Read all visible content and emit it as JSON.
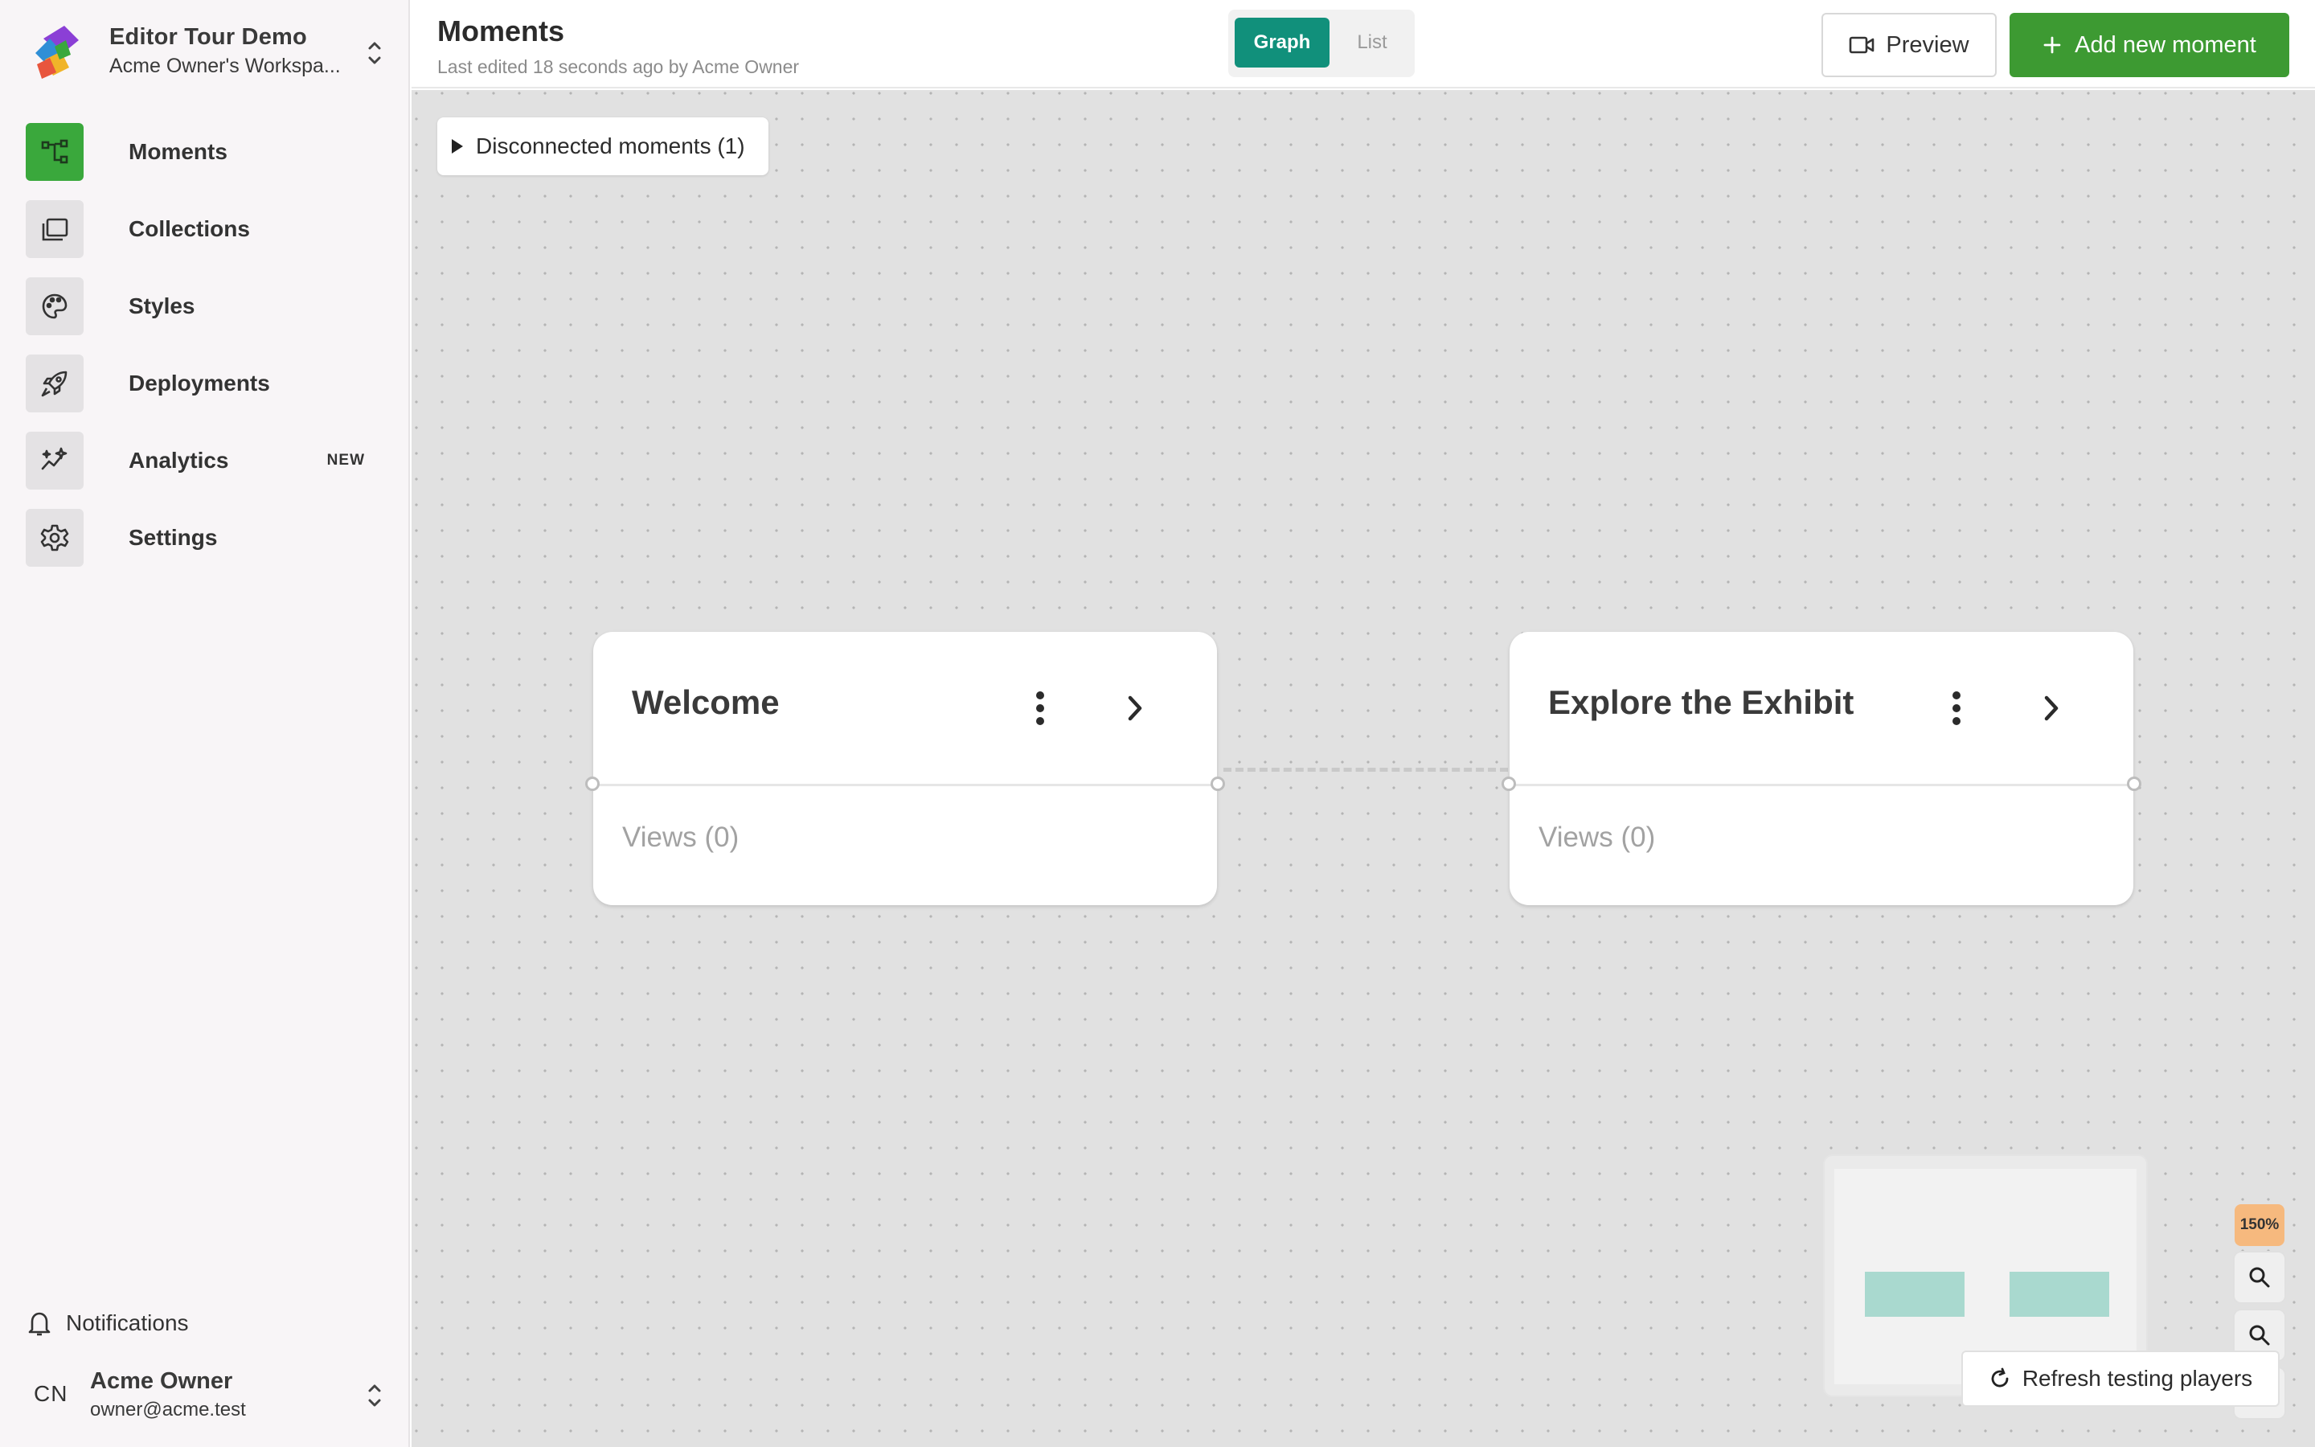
{
  "workspace": {
    "name": "Editor Tour Demo",
    "owner_label": "Acme Owner's Workspa..."
  },
  "sidebar": {
    "items": [
      {
        "label": "Moments",
        "icon": "moments-graph-icon",
        "active": true
      },
      {
        "label": "Collections",
        "icon": "collections-icon",
        "active": false
      },
      {
        "label": "Styles",
        "icon": "palette-icon",
        "active": false
      },
      {
        "label": "Deployments",
        "icon": "rocket-icon",
        "active": false
      },
      {
        "label": "Analytics",
        "icon": "analytics-sparkle-icon",
        "active": false,
        "badge": "NEW"
      },
      {
        "label": "Settings",
        "icon": "gear-icon",
        "active": false
      }
    ],
    "notifications_label": "Notifications",
    "user": {
      "initials": "CN",
      "name": "Acme Owner",
      "email": "owner@acme.test"
    }
  },
  "header": {
    "title": "Moments",
    "subtitle": "Last edited 18 seconds ago by Acme Owner",
    "view_toggle": {
      "graph": "Graph",
      "list": "List",
      "selected": "Graph"
    },
    "preview_label": "Preview",
    "add_label": "Add new moment"
  },
  "canvas": {
    "disconnected_label": "Disconnected moments (1)",
    "nodes": [
      {
        "title": "Welcome",
        "views_label": "Views (0)"
      },
      {
        "title": "Explore the Exhibit",
        "views_label": "Views (0)"
      }
    ],
    "zoom_label": "150%",
    "refresh_label": "Refresh testing players"
  },
  "colors": {
    "accent_green": "#3d9a32",
    "active_nav_green": "#3aa83c",
    "graph_toggle_teal": "#11907b",
    "zoom_badge_orange": "#f6b97e",
    "minimap_node": "#a9d9cf"
  }
}
